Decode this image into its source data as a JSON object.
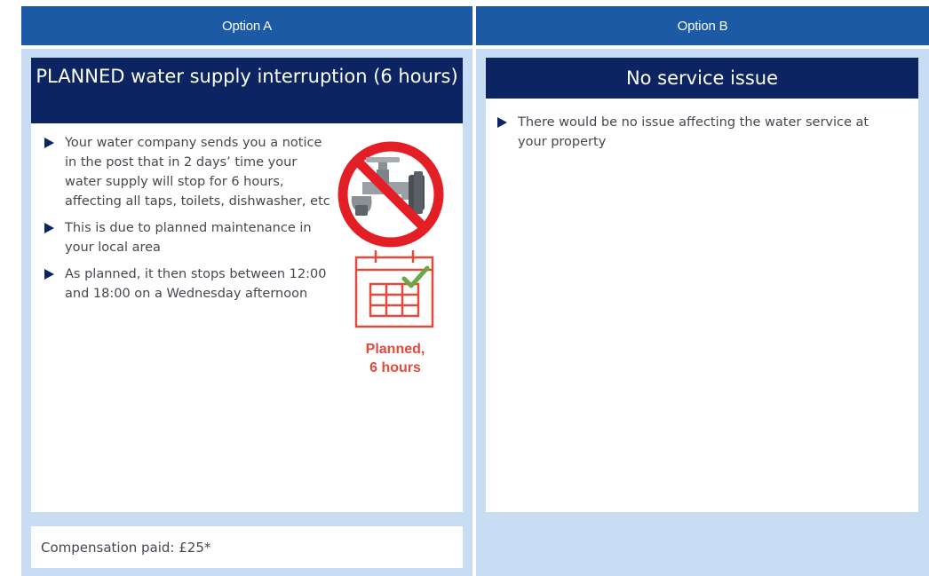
{
  "option_a": {
    "header": "Option A",
    "title_strong": "PLANNED",
    "title_rest": " water supply interruption (6 hours)",
    "bullets": [
      "Your water company sends you a notice in the post that in 2 days’ time your water supply will stop for 6 hours, affecting all taps, toilets, dishwasher, etc",
      "This is due to planned maintenance in your local area",
      "As planned, it then stops between 12:00 and 18:00 on a Wednesday afternoon"
    ],
    "caption_line1": "Planned,",
    "caption_line2": "6 hours",
    "compensation": "Compensation paid: £25*"
  },
  "option_b": {
    "header": "Option B",
    "title": "No service issue",
    "bullets": [
      "There would be no issue affecting the water service at your property"
    ]
  },
  "icons": {
    "no_water": "no-water-tap-icon",
    "calendar": "calendar-check-icon",
    "bullet": "triangle-bullet-icon"
  },
  "colors": {
    "header_blue": "#1c5aa6",
    "panel_bg": "#c8dcf4",
    "title_navy": "#0c2461",
    "accent_red": "#e24b3b",
    "check_green": "#6aa842"
  }
}
